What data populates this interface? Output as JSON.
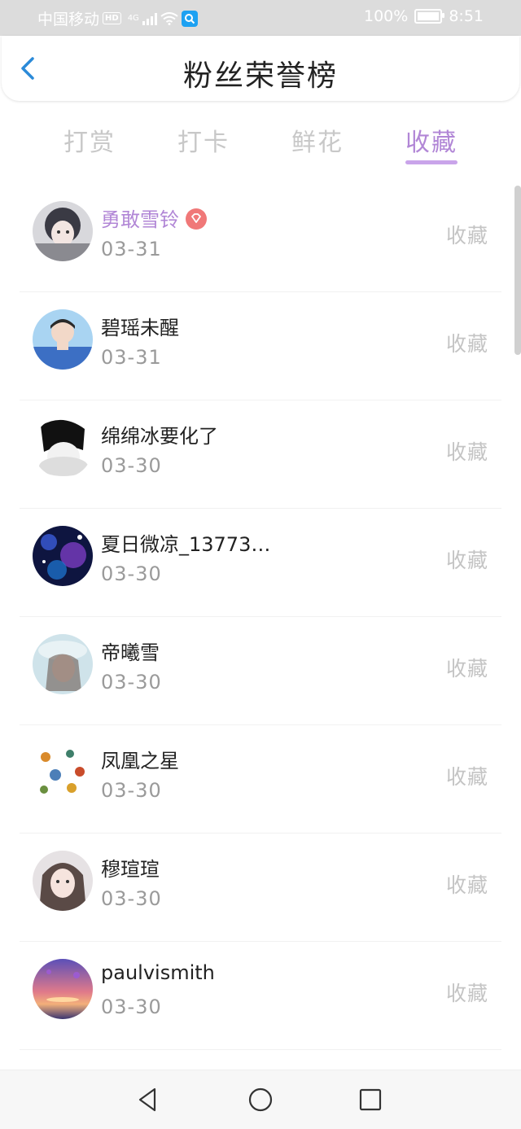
{
  "status_bar": {
    "carrier": "中国移动",
    "hd": "HD",
    "network": "4G",
    "battery": "100%",
    "time": "8:51",
    "icons": [
      "signal-icon",
      "wifi-icon",
      "search-app-icon",
      "battery-icon"
    ]
  },
  "header": {
    "title": "粉丝荣誉榜",
    "back_icon": "chevron-left-icon"
  },
  "tabs": [
    {
      "label": "打赏",
      "active": false
    },
    {
      "label": "打卡",
      "active": false
    },
    {
      "label": "鲜花",
      "active": false
    },
    {
      "label": "收藏",
      "active": true
    }
  ],
  "fans": [
    {
      "name": "勇敢雪铃",
      "date": "03-31",
      "action": "收藏",
      "highlight": true,
      "badge": "vip-diamond-icon"
    },
    {
      "name": "碧瑶未醒",
      "date": "03-31",
      "action": "收藏",
      "highlight": false
    },
    {
      "name": "绵绵冰要化了",
      "date": "03-30",
      "action": "收藏",
      "highlight": false
    },
    {
      "name": "夏日微凉_13773…",
      "date": "03-30",
      "action": "收藏",
      "highlight": false
    },
    {
      "name": "帝曦雪",
      "date": "03-30",
      "action": "收藏",
      "highlight": false
    },
    {
      "name": "凤凰之星",
      "date": "03-30",
      "action": "收藏",
      "highlight": false
    },
    {
      "name": "穆瑄瑄",
      "date": "03-30",
      "action": "收藏",
      "highlight": false
    },
    {
      "name": "paulvismith",
      "date": "03-30",
      "action": "收藏",
      "highlight": false
    }
  ],
  "colors": {
    "accent": "#b186d6",
    "accent_underline": "#c9a4ea",
    "muted": "#c4c4c4",
    "badge": "#f07878"
  },
  "nav_bar": [
    "back-triangle-icon",
    "home-circle-icon",
    "recents-square-icon"
  ]
}
